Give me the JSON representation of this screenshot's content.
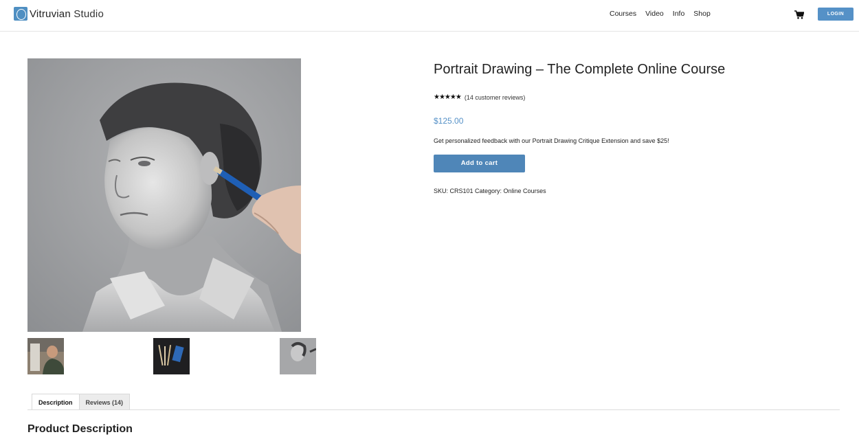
{
  "header": {
    "logo_text_1": "Vitruvian",
    "logo_text_2": "Studio",
    "nav": [
      "Courses",
      "Video",
      "Info",
      "Shop"
    ],
    "login_label": "LOGIN"
  },
  "product": {
    "title": "Portrait Drawing – The Complete Online Course",
    "rating": 5,
    "stars": "★★★★★",
    "reviews_label": "(14 customer reviews)",
    "price": "$125.00",
    "promo": "Get personalized feedback with our Portrait Drawing Critique Extension and save $25!",
    "add_to_cart": "Add to cart",
    "meta": "SKU: CRS101 Category: Online Courses"
  },
  "tabs": [
    {
      "label": "Description",
      "active": true
    },
    {
      "label": "Reviews (14)",
      "active": false
    }
  ],
  "description_heading": "Product Description",
  "colors": {
    "accent": "#5591c7",
    "button": "#4f86b8"
  }
}
